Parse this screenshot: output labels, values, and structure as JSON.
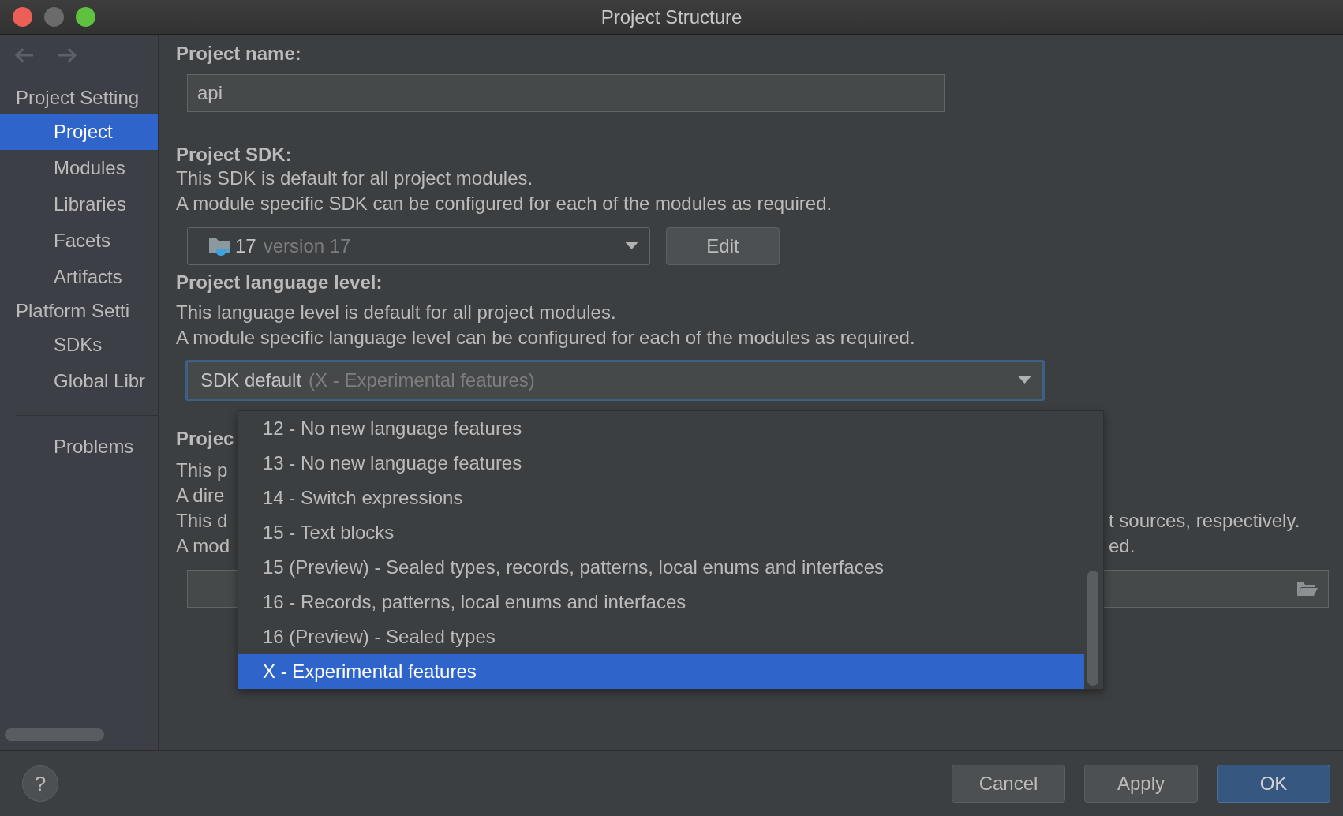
{
  "window": {
    "title": "Project Structure"
  },
  "sidebar": {
    "sections": [
      {
        "title": "Project Setting",
        "items": [
          {
            "label": "Project",
            "selected": true
          },
          {
            "label": "Modules",
            "selected": false
          },
          {
            "label": "Libraries",
            "selected": false
          },
          {
            "label": "Facets",
            "selected": false
          },
          {
            "label": "Artifacts",
            "selected": false
          }
        ]
      },
      {
        "title": "Platform Setti",
        "items": [
          {
            "label": "SDKs",
            "selected": false
          },
          {
            "label": "Global Libr",
            "selected": false
          }
        ]
      }
    ],
    "bottom_items": [
      {
        "label": "Problems",
        "selected": false
      }
    ]
  },
  "project_name": {
    "label": "Project name:",
    "value": "api"
  },
  "project_sdk": {
    "label": "Project SDK:",
    "description": [
      "This SDK is default for all project modules.",
      "A module specific SDK can be configured for each of the modules as required."
    ],
    "combo": {
      "value": "17",
      "detail": "version 17"
    },
    "edit_button": "Edit"
  },
  "language_level": {
    "label": "Project language level:",
    "description": [
      "This language level is default for all project modules.",
      "A module specific language level can be configured for each of the modules as required."
    ],
    "combo": {
      "value": "SDK default",
      "detail": "(X - Experimental features)",
      "expanded": true
    },
    "options": [
      {
        "label": "12 - No new language features",
        "selected": false
      },
      {
        "label": "13 - No new language features",
        "selected": false
      },
      {
        "label": "14 - Switch expressions",
        "selected": false
      },
      {
        "label": "15 - Text blocks",
        "selected": false
      },
      {
        "label": "15 (Preview) - Sealed types, records, patterns, local enums and interfaces",
        "selected": false
      },
      {
        "label": "16 - Records, patterns, local enums and interfaces",
        "selected": false
      },
      {
        "label": "16 (Preview) - Sealed types",
        "selected": false
      },
      {
        "label": "X - Experimental features",
        "selected": true
      }
    ]
  },
  "compiler_output": {
    "label": "Projec",
    "lines": [
      {
        "left": "This p"
      },
      {
        "left": "A dire"
      },
      {
        "left": "This d",
        "right": "t sources, respectively."
      },
      {
        "left": "A mod",
        "right": "ed."
      }
    ]
  },
  "help_button": "?",
  "buttons": [
    {
      "label": "Cancel",
      "kind": "default"
    },
    {
      "label": "Apply",
      "kind": "default"
    },
    {
      "label": "OK",
      "kind": "primary"
    }
  ]
}
